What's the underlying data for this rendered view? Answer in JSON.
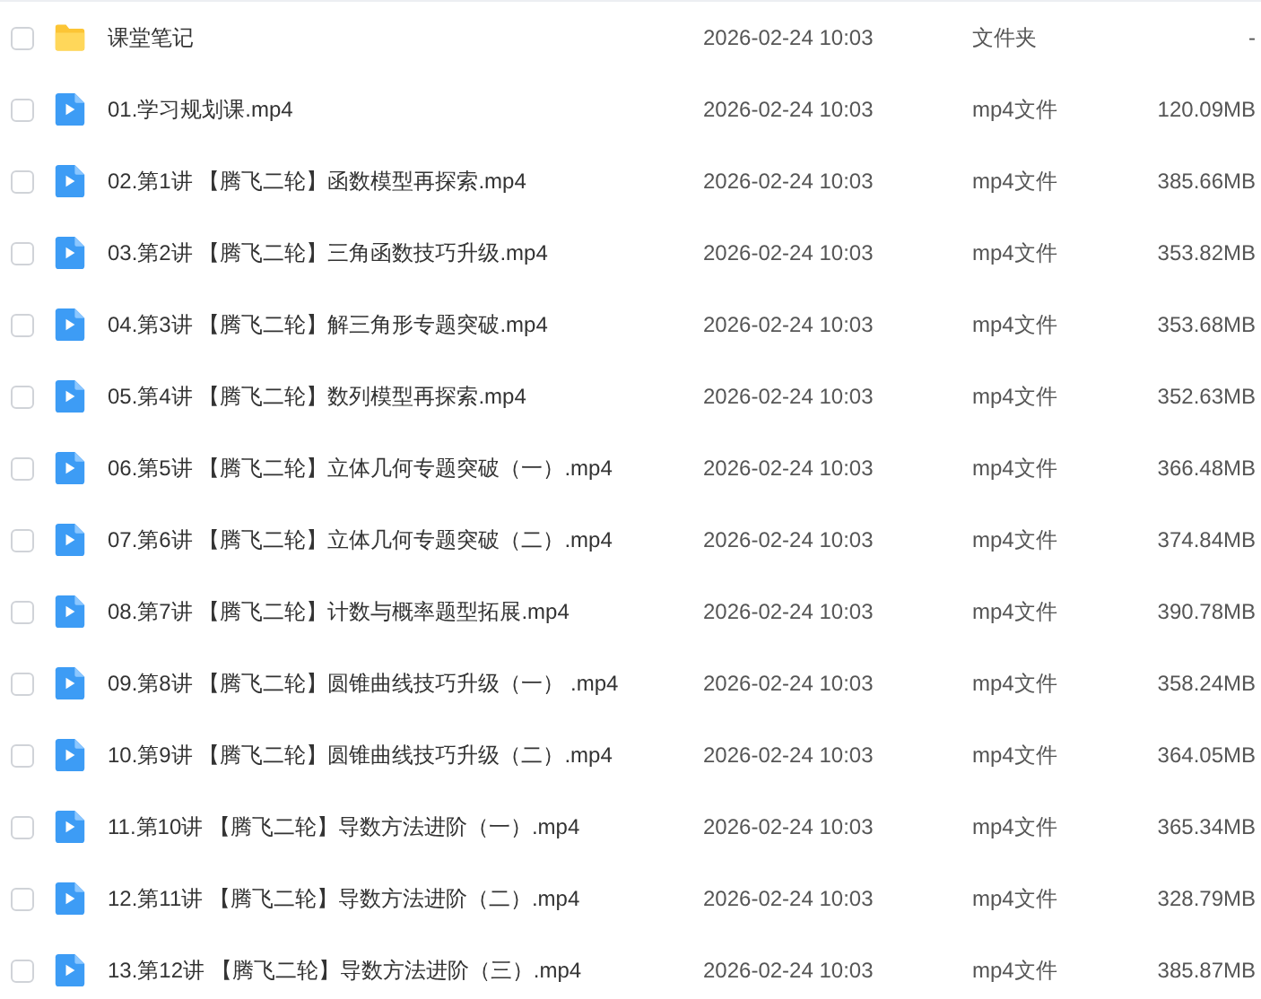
{
  "files": [
    {
      "kind": "folder",
      "checked": false,
      "name": "课堂笔记",
      "modified": "2026-02-24 10:03",
      "type": "文件夹",
      "size": "-"
    },
    {
      "kind": "video",
      "checked": false,
      "name": "01.学习规划课.mp4",
      "modified": "2026-02-24 10:03",
      "type": "mp4文件",
      "size": "120.09MB"
    },
    {
      "kind": "video",
      "checked": false,
      "name": "02.第1讲 【腾飞二轮】函数模型再探索.mp4",
      "modified": "2026-02-24 10:03",
      "type": "mp4文件",
      "size": "385.66MB"
    },
    {
      "kind": "video",
      "checked": false,
      "name": "03.第2讲 【腾飞二轮】三角函数技巧升级.mp4",
      "modified": "2026-02-24 10:03",
      "type": "mp4文件",
      "size": "353.82MB"
    },
    {
      "kind": "video",
      "checked": false,
      "name": "04.第3讲 【腾飞二轮】解三角形专题突破.mp4",
      "modified": "2026-02-24 10:03",
      "type": "mp4文件",
      "size": "353.68MB"
    },
    {
      "kind": "video",
      "checked": false,
      "name": "05.第4讲 【腾飞二轮】数列模型再探索.mp4",
      "modified": "2026-02-24 10:03",
      "type": "mp4文件",
      "size": "352.63MB"
    },
    {
      "kind": "video",
      "checked": false,
      "name": "06.第5讲 【腾飞二轮】立体几何专题突破（一）.mp4",
      "modified": "2026-02-24 10:03",
      "type": "mp4文件",
      "size": "366.48MB"
    },
    {
      "kind": "video",
      "checked": false,
      "name": "07.第6讲 【腾飞二轮】立体几何专题突破（二）.mp4",
      "modified": "2026-02-24 10:03",
      "type": "mp4文件",
      "size": "374.84MB"
    },
    {
      "kind": "video",
      "checked": false,
      "name": "08.第7讲 【腾飞二轮】计数与概率题型拓展.mp4",
      "modified": "2026-02-24 10:03",
      "type": "mp4文件",
      "size": "390.78MB"
    },
    {
      "kind": "video",
      "checked": false,
      "name": "09.第8讲 【腾飞二轮】圆锥曲线技巧升级（一） .mp4",
      "modified": "2026-02-24 10:03",
      "type": "mp4文件",
      "size": "358.24MB"
    },
    {
      "kind": "video",
      "checked": false,
      "name": "10.第9讲 【腾飞二轮】圆锥曲线技巧升级（二）.mp4",
      "modified": "2026-02-24 10:03",
      "type": "mp4文件",
      "size": "364.05MB"
    },
    {
      "kind": "video",
      "checked": false,
      "name": "11.第10讲 【腾飞二轮】导数方法进阶（一）.mp4",
      "modified": "2026-02-24 10:03",
      "type": "mp4文件",
      "size": "365.34MB"
    },
    {
      "kind": "video",
      "checked": false,
      "name": "12.第11讲 【腾飞二轮】导数方法进阶（二）.mp4",
      "modified": "2026-02-24 10:03",
      "type": "mp4文件",
      "size": "328.79MB"
    },
    {
      "kind": "video",
      "checked": false,
      "name": "13.第12讲 【腾飞二轮】导数方法进阶（三）.mp4",
      "modified": "2026-02-24 10:03",
      "type": "mp4文件",
      "size": "385.87MB"
    }
  ]
}
